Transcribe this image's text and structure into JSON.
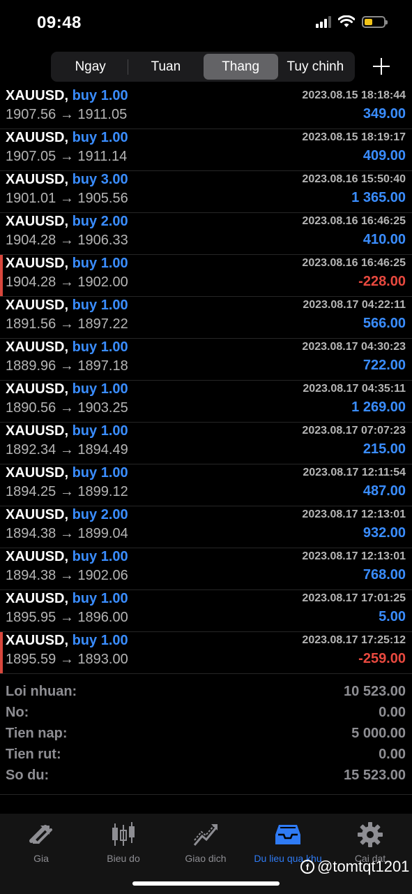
{
  "status_bar": {
    "time": "09:48"
  },
  "tabs": [
    "Ngay",
    "Tuan",
    "Thang",
    "Tuy chinh"
  ],
  "active_tab": "Thang",
  "colors": {
    "accent": "#3a8dff",
    "negative": "#e8493f",
    "battery": "#f2c418"
  },
  "trades": [
    {
      "symbol": "XAUUSD,",
      "side": "buy 1.00",
      "prices": "1907.56 → 1911.05",
      "time": "2023.08.15 18:18:44",
      "profit": "349.00",
      "negative": false
    },
    {
      "symbol": "XAUUSD,",
      "side": "buy 1.00",
      "prices": "1907.05 → 1911.14",
      "time": "2023.08.15 18:19:17",
      "profit": "409.00",
      "negative": false
    },
    {
      "symbol": "XAUUSD,",
      "side": "buy 3.00",
      "prices": "1901.01 → 1905.56",
      "time": "2023.08.16 15:50:40",
      "profit": "1 365.00",
      "negative": false
    },
    {
      "symbol": "XAUUSD,",
      "side": "buy 2.00",
      "prices": "1904.28 → 1906.33",
      "time": "2023.08.16 16:46:25",
      "profit": "410.00",
      "negative": false
    },
    {
      "symbol": "XAUUSD,",
      "side": "buy 1.00",
      "prices": "1904.28 → 1902.00",
      "time": "2023.08.16 16:46:25",
      "profit": "-228.00",
      "negative": true
    },
    {
      "symbol": "XAUUSD,",
      "side": "buy 1.00",
      "prices": "1891.56 → 1897.22",
      "time": "2023.08.17 04:22:11",
      "profit": "566.00",
      "negative": false
    },
    {
      "symbol": "XAUUSD,",
      "side": "buy 1.00",
      "prices": "1889.96 → 1897.18",
      "time": "2023.08.17 04:30:23",
      "profit": "722.00",
      "negative": false
    },
    {
      "symbol": "XAUUSD,",
      "side": "buy 1.00",
      "prices": "1890.56 → 1903.25",
      "time": "2023.08.17 04:35:11",
      "profit": "1 269.00",
      "negative": false
    },
    {
      "symbol": "XAUUSD,",
      "side": "buy 1.00",
      "prices": "1892.34 → 1894.49",
      "time": "2023.08.17 07:07:23",
      "profit": "215.00",
      "negative": false
    },
    {
      "symbol": "XAUUSD,",
      "side": "buy 1.00",
      "prices": "1894.25 → 1899.12",
      "time": "2023.08.17 12:11:54",
      "profit": "487.00",
      "negative": false
    },
    {
      "symbol": "XAUUSD,",
      "side": "buy 2.00",
      "prices": "1894.38 → 1899.04",
      "time": "2023.08.17 12:13:01",
      "profit": "932.00",
      "negative": false
    },
    {
      "symbol": "XAUUSD,",
      "side": "buy 1.00",
      "prices": "1894.38 → 1902.06",
      "time": "2023.08.17 12:13:01",
      "profit": "768.00",
      "negative": false
    },
    {
      "symbol": "XAUUSD,",
      "side": "buy 1.00",
      "prices": "1895.95 → 1896.00",
      "time": "2023.08.17 17:01:25",
      "profit": "5.00",
      "negative": false
    },
    {
      "symbol": "XAUUSD,",
      "side": "buy 1.00",
      "prices": "1895.59 → 1893.00",
      "time": "2023.08.17 17:25:12",
      "profit": "-259.00",
      "negative": true
    }
  ],
  "summary": [
    {
      "label": "Loi nhuan:",
      "value": "10 523.00"
    },
    {
      "label": "No:",
      "value": "0.00"
    },
    {
      "label": "Tien nap:",
      "value": "5 000.00"
    },
    {
      "label": "Tien rut:",
      "value": "0.00"
    },
    {
      "label": "So du:",
      "value": "15 523.00"
    }
  ],
  "tabbar": [
    {
      "label": "Gia",
      "icon": "quotes-arrows-icon"
    },
    {
      "label": "Bieu do",
      "icon": "candlestick-icon"
    },
    {
      "label": "Giao dich",
      "icon": "trade-line-icon"
    },
    {
      "label": "Du lieu qua khu",
      "icon": "history-inbox-icon"
    },
    {
      "label": "Cai dat",
      "icon": "gear-icon"
    }
  ],
  "active_bottom_tab": "Du lieu qua khu",
  "watermark": "@tomtqt1201"
}
